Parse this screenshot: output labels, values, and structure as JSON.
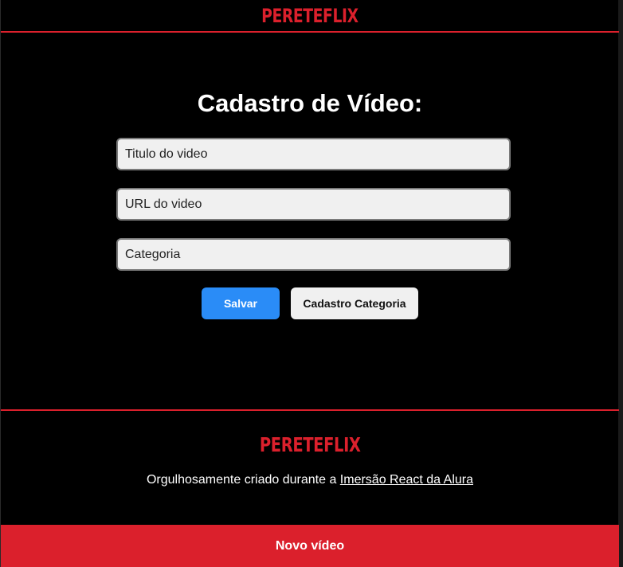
{
  "header": {
    "logo_text": "PERETEFLIX"
  },
  "page": {
    "title": "Cadastro de Vídeo:"
  },
  "form": {
    "title_placeholder": "Titulo do video",
    "url_placeholder": "URL do video",
    "category_placeholder": "Categoria",
    "save_label": "Salvar",
    "category_button_label": "Cadastro Categoria"
  },
  "footer": {
    "logo_text": "PERETEFLIX",
    "text": "Orgulhosamente criado durante a ",
    "link_text": "Imersão React da Alura"
  },
  "bottom_nav": {
    "new_video_label": "Novo vídeo"
  },
  "colors": {
    "brand_red": "#db202c",
    "primary_button": "#2a8cf7",
    "background": "#000000",
    "input_bg": "#f0f0f0"
  }
}
